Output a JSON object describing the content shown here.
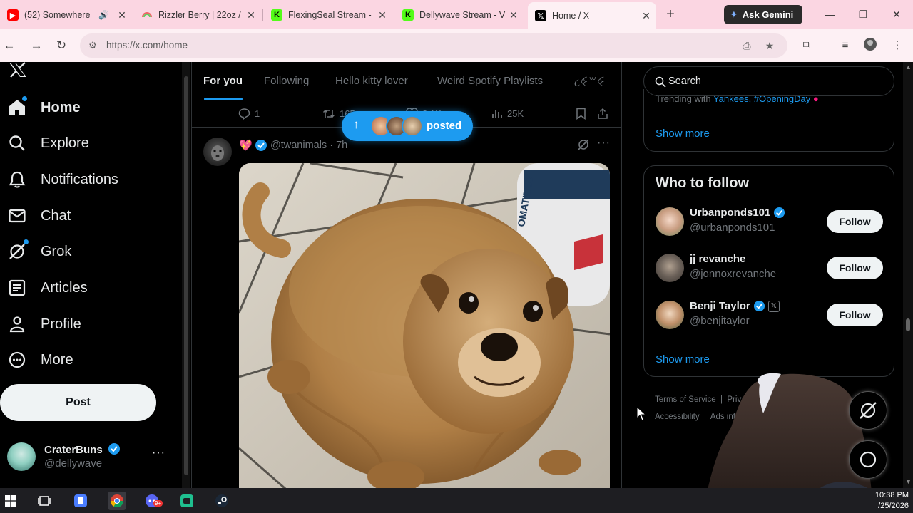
{
  "browser": {
    "tabs": [
      {
        "label": "(52) Somewhere",
        "favicon_color": "#ff0000",
        "muted_icon": "speaker-icon"
      },
      {
        "label": "Rizzler Berry | 22oz /",
        "favicon_color": "#8ab4f8"
      },
      {
        "label": "FlexingSeal Stream -",
        "favicon_color": "#53fc18",
        "favicon_text": "K"
      },
      {
        "label": "Dellywave Stream - V",
        "favicon_color": "#53fc18",
        "favicon_text": "K"
      },
      {
        "label": "Home / X",
        "favicon_color": "#000000",
        "favicon_text": "𝕏"
      }
    ],
    "new_tab": "+",
    "gemini_label": "Ask Gemini",
    "url": "https://x.com/home"
  },
  "nav": {
    "items": [
      {
        "label": "Home",
        "icon": "home-icon",
        "active": true
      },
      {
        "label": "Explore",
        "icon": "search-icon"
      },
      {
        "label": "Notifications",
        "icon": "bell-icon"
      },
      {
        "label": "Chat",
        "icon": "mail-icon"
      },
      {
        "label": "Grok",
        "icon": "grok-icon"
      },
      {
        "label": "Articles",
        "icon": "article-icon"
      },
      {
        "label": "Profile",
        "icon": "person-icon"
      },
      {
        "label": "More",
        "icon": "more-circle-icon"
      }
    ],
    "post_label": "Post",
    "account": {
      "name": "CraterBuns",
      "handle": "@dellywave",
      "more": "···"
    }
  },
  "feed": {
    "tabs": [
      "For you",
      "Following",
      "Hello kitty lover",
      "Weird Spotify Playlists",
      "૮ꒊ꒳ꒊ"
    ],
    "prev_actions": {
      "replies": "1",
      "reposts": "165",
      "likes": "2.1K",
      "views": "25K"
    },
    "posted_pill": "posted",
    "tweet": {
      "handle": "@twanimals · 7h",
      "emoji": "💖"
    }
  },
  "sidebar": {
    "search_placeholder": "Search",
    "trending_prefix": "Trending with ",
    "trending_tags": "Yankees, #OpeningDay",
    "show_more": "Show more",
    "who_to_follow": {
      "title": "Who to follow",
      "users": [
        {
          "name": "Urbanponds101",
          "handle": "@urbanponds101",
          "verified": true,
          "follow": "Follow"
        },
        {
          "name": "jj revanche",
          "handle": "@jonnoxrevanche",
          "verified": false,
          "follow": "Follow"
        },
        {
          "name": "Benji Taylor",
          "handle": "@benjitaylor",
          "verified": true,
          "follow": "Follow"
        }
      ],
      "show_more": "Show more"
    },
    "footer": {
      "line1": [
        "Terms of Service",
        "|",
        "Privac",
        "olicy"
      ],
      "line2": [
        "Accessibility",
        "|",
        "Ads info",
        "Co"
      ]
    }
  },
  "taskbar": {
    "time": "10:38 PM",
    "date": "/25/2026"
  },
  "colors": {
    "accent": "#1d9bf0",
    "background": "#000000",
    "text": "#e7e9ea",
    "muted": "#71767b",
    "chrome_pink": "#fbd6e2"
  }
}
